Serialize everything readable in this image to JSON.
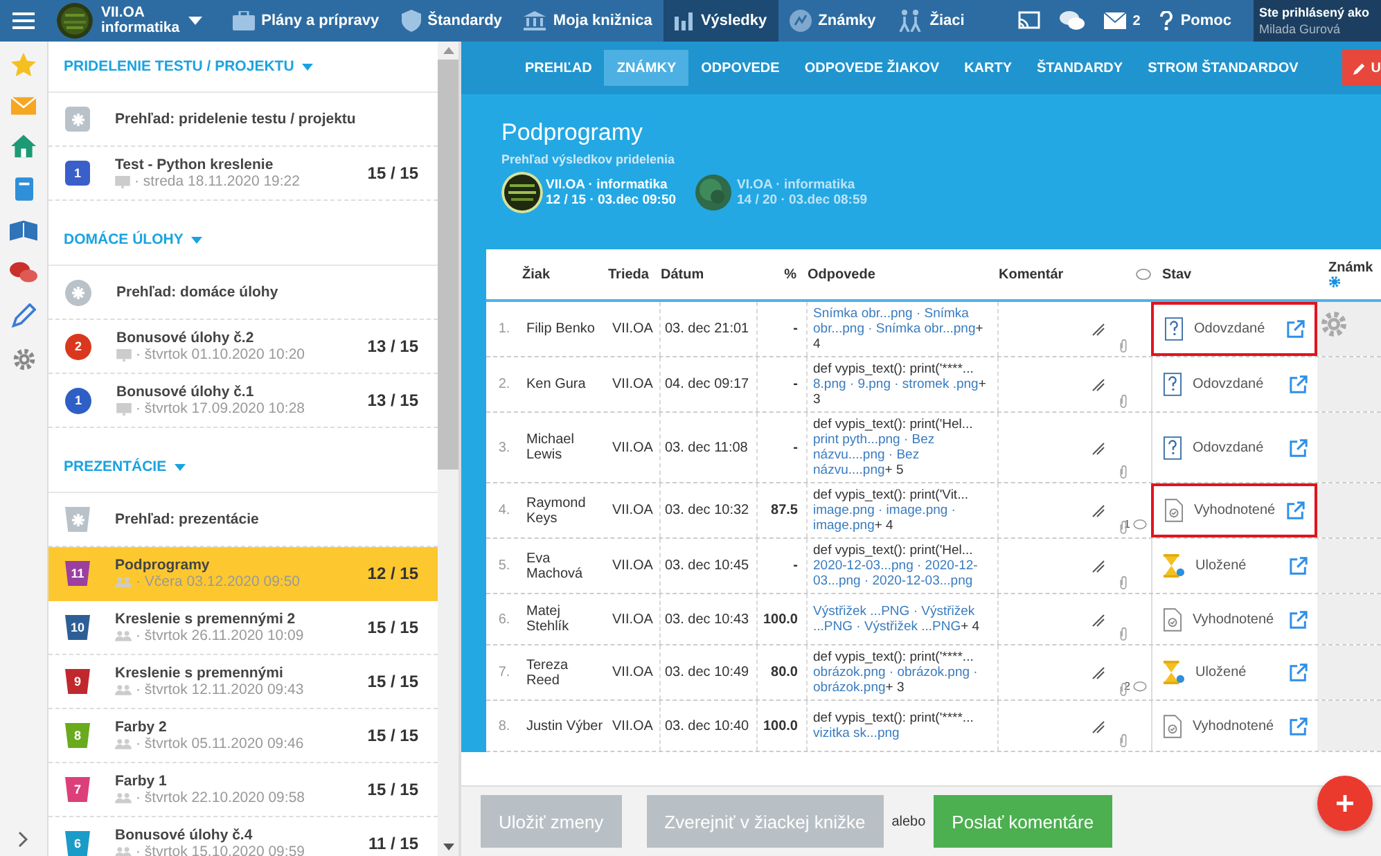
{
  "topbar": {
    "class_name": "VII.OA",
    "subject": "informatika",
    "nav": [
      {
        "label": "Plány a prípravy",
        "selected": false
      },
      {
        "label": "Štandardy",
        "selected": false
      },
      {
        "label": "Moja knižnica",
        "selected": false
      },
      {
        "label": "Výsledky",
        "selected": true
      },
      {
        "label": "Známky",
        "selected": false
      },
      {
        "label": "Žiaci",
        "selected": false
      }
    ],
    "mail_count": "2",
    "help": "Pomoc",
    "user_caption": "Ste prihlásený ako",
    "user_name": "Milada Gurová"
  },
  "sidebar": {
    "sections": [
      {
        "title": "PRIDELENIE TESTU / PROJEKTU",
        "kind": "square",
        "items": [
          {
            "kind": "overview",
            "title": "Prehľad: pridelenie testu / projektu",
            "selected": false
          },
          {
            "kind": "item",
            "number": "1",
            "color": "#3a5fc8",
            "title": "Test - Python kreslenie",
            "meta": "· streda 18.11.2020 19:22",
            "score": "15 / 15",
            "selected": false
          }
        ]
      },
      {
        "title": "DOMÁCE ÚLOHY",
        "kind": "circle",
        "items": [
          {
            "kind": "overview",
            "title": "Prehľad: domáce úlohy",
            "selected": false
          },
          {
            "kind": "item",
            "number": "2",
            "color": "#d9381e",
            "title": "Bonusové úlohy č.2",
            "meta": "· štvrtok 01.10.2020 10:20",
            "score": "13 / 15",
            "selected": false
          },
          {
            "kind": "item",
            "number": "1",
            "color": "#2f5fc4",
            "title": "Bonusové úlohy č.1",
            "meta": "· štvrtok 17.09.2020 10:28",
            "score": "13 / 15",
            "selected": false
          }
        ]
      },
      {
        "title": "PREZENTÁCIE",
        "kind": "cup",
        "items": [
          {
            "kind": "overview",
            "title": "Prehľad: prezentácie",
            "selected": false
          },
          {
            "kind": "item",
            "number": "11",
            "color": "#9b3fa0",
            "title": "Podprogramy",
            "meta": "· Včera 03.12.2020 09:50",
            "score": "12 / 15",
            "selected": true
          },
          {
            "kind": "item",
            "number": "10",
            "color": "#2d5f96",
            "title": "Kreslenie s premennými 2",
            "meta": "· štvrtok 26.11.2020 10:09",
            "score": "15 / 15",
            "selected": false
          },
          {
            "kind": "item",
            "number": "9",
            "color": "#c0282e",
            "title": "Kreslenie s premennými",
            "meta": "· štvrtok 12.11.2020 09:43",
            "score": "15 / 15",
            "selected": false
          },
          {
            "kind": "item",
            "number": "8",
            "color": "#6aaa1e",
            "title": "Farby 2",
            "meta": "· štvrtok 05.11.2020 09:46",
            "score": "15 / 15",
            "selected": false
          },
          {
            "kind": "item",
            "number": "7",
            "color": "#dd3f7a",
            "title": "Farby 1",
            "meta": "· štvrtok 22.10.2020 09:58",
            "score": "15 / 15",
            "selected": false
          },
          {
            "kind": "item",
            "number": "6",
            "color": "#1a9bc8",
            "title": "Bonusové úlohy č.4",
            "meta": "· štvrtok 15.10.2020 09:59",
            "score": "11 / 15",
            "selected": false
          }
        ]
      }
    ]
  },
  "tabs": [
    {
      "label": "PREHĽAD",
      "selected": false
    },
    {
      "label": "ZNÁMKY",
      "selected": true
    },
    {
      "label": "ODPOVEDE",
      "selected": false
    },
    {
      "label": "ODPOVEDE ŽIAKOV",
      "selected": false
    },
    {
      "label": "KARTY",
      "selected": false
    },
    {
      "label": "ŠTANDARDY",
      "selected": false
    },
    {
      "label": "STROM ŠTANDARDOV",
      "selected": false
    }
  ],
  "edit_button": "U",
  "header": {
    "title": "Podprogramy",
    "subtitle": "Prehľad výsledkov pridelenia",
    "classes": [
      {
        "name": "VII.OA · informatika",
        "info": "12 / 15 · 03.dec 09:50",
        "selected": true
      },
      {
        "name": "VI.OA · informatika",
        "info": "14 / 20 · 03.dec 08:59",
        "selected": false
      }
    ]
  },
  "table": {
    "columns": [
      "Žiak",
      "Trieda",
      "Dátum",
      "%",
      "Odpovede",
      "Komentár",
      "Stav",
      "Známk"
    ],
    "rows": [
      {
        "number": "1.",
        "name": "Filip Benko",
        "class": "VII.OA",
        "date": "03. dec 21:01",
        "percent": "-",
        "answers": [
          {
            "kind": "link",
            "text": "Snímka obr...png · Snímka obr...png · Snímka obr...png"
          },
          {
            "kind": "more",
            "text": "+ 4"
          }
        ],
        "status": {
          "kind": "submitted",
          "label": "Odovzdané"
        },
        "highlighted": true
      },
      {
        "number": "2.",
        "name": "Ken Gura",
        "class": "VII.OA",
        "date": "04. dec 09:17",
        "percent": "-",
        "answers": [
          {
            "kind": "code",
            "text": "def vypis_text(): print('****..."
          },
          {
            "kind": "link",
            "text": "8.png · 9.png · stromek .png"
          },
          {
            "kind": "more",
            "text": "+ 3"
          }
        ],
        "status": {
          "kind": "submitted",
          "label": "Odovzdané"
        },
        "highlighted": false
      },
      {
        "number": "3.",
        "name": "Michael Lewis",
        "class": "VII.OA",
        "date": "03. dec 11:08",
        "percent": "-",
        "answers": [
          {
            "kind": "code",
            "text": "def vypis_text(): print('Hel..."
          },
          {
            "kind": "link",
            "text": "print pyth...png · Bez názvu....png · Bez názvu....png"
          },
          {
            "kind": "more",
            "text": "+ 5"
          }
        ],
        "status": {
          "kind": "submitted",
          "label": "Odovzdané"
        },
        "highlighted": false
      },
      {
        "number": "4.",
        "name": "Raymond Keys",
        "class": "VII.OA",
        "date": "03. dec 10:32",
        "percent": "87.5",
        "answers": [
          {
            "kind": "code",
            "text": "def vypis_text(): print('Vit..."
          },
          {
            "kind": "link",
            "text": "image.png · image.png · image.png"
          },
          {
            "kind": "more",
            "text": "+ 4"
          }
        ],
        "comments": "1",
        "status": {
          "kind": "evaluated",
          "label": "Vyhodnotené"
        },
        "highlighted": true
      },
      {
        "number": "5.",
        "name": "Eva Machová",
        "class": "VII.OA",
        "date": "03. dec 10:45",
        "percent": "-",
        "answers": [
          {
            "kind": "code",
            "text": "def vypis_text(): print('Hel..."
          },
          {
            "kind": "link",
            "text": "2020-12-03...png · 2020-12-03...png · 2020-12-03...png"
          }
        ],
        "status": {
          "kind": "saved",
          "label": "Uložené"
        },
        "highlighted": false
      },
      {
        "number": "6.",
        "name": "Matej Stehlík",
        "class": "VII.OA",
        "date": "03. dec 10:43",
        "percent": "100.0",
        "answers": [
          {
            "kind": "link",
            "text": "Výstřižek ...PNG · Výstřižek ...PNG · Výstřižek ...PNG"
          },
          {
            "kind": "more",
            "text": "+ 4"
          }
        ],
        "status": {
          "kind": "evaluated",
          "label": "Vyhodnotené"
        },
        "highlighted": false
      },
      {
        "number": "7.",
        "name": "Tereza Reed",
        "class": "VII.OA",
        "date": "03. dec 10:49",
        "percent": "80.0",
        "answers": [
          {
            "kind": "code",
            "text": "def vypis_text(): print('****..."
          },
          {
            "kind": "link",
            "text": "obrázok.png · obrázok.png · obrázok.png"
          },
          {
            "kind": "more",
            "text": "+ 3"
          }
        ],
        "comments": "2",
        "status": {
          "kind": "saved",
          "label": "Uložené"
        },
        "highlighted": false
      },
      {
        "number": "8.",
        "name": "Justin Výber",
        "class": "VII.OA",
        "date": "03. dec 10:40",
        "percent": "100.0",
        "answers": [
          {
            "kind": "code",
            "text": "def vypis_text(): print('****..."
          },
          {
            "kind": "link",
            "text": "vizitka sk...png"
          }
        ],
        "status": {
          "kind": "evaluated",
          "label": "Vyhodnotené"
        },
        "highlighted": false
      }
    ]
  },
  "footer": [
    {
      "kind": "button",
      "label": "Uložiť zmeny",
      "disabled": true
    },
    {
      "kind": "button",
      "label": "Zverejniť v žiackej knižke",
      "disabled": true
    },
    {
      "kind": "text",
      "label": "alebo"
    },
    {
      "kind": "button",
      "label": "Poslať komentáre",
      "disabled": false
    }
  ]
}
